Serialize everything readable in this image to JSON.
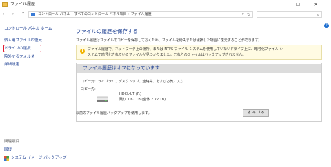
{
  "window": {
    "title": "ファイル履歴",
    "minimize": "—",
    "maximize": "☐",
    "close": "✕"
  },
  "nav": {
    "back": "←",
    "forward": "→",
    "up": "↑"
  },
  "address": {
    "crumbs": [
      "コントロール パネル",
      "すべてのコントロール パネル項目",
      "ファイル履歴"
    ],
    "separator": "›",
    "dropdown": "∨",
    "refresh": "↻"
  },
  "search": {
    "placeholder": "",
    "icon": "search-icon"
  },
  "help": "?",
  "sidebar": {
    "home": "コントロール パネル ホーム",
    "items": [
      "個人用ファイルの復元",
      "ドライブの選択",
      "除外するフォルダー",
      "詳細設定"
    ],
    "related_heading": "関連項目",
    "related": [
      "回復",
      "システム イメージ バックアップ"
    ]
  },
  "main": {
    "heading": "ファイルの履歴を保存する",
    "description": "ファイル履歴はファイルのコピーを保存しておくため、ファイルを紛失または破損した場合に復元することができます。",
    "info_lines": [
      "ファイル履歴で、ネットワーク上の場所、または NTFS ファイル システムを使用していないドライブ上に、暗号化ファイル シ",
      "ステムで暗号化されているファイルが見つかりました。これらのファイルはバックアップされません。"
    ],
    "panel_title": "ファイル履歴はオフになっています",
    "copy_label": "コピー元:",
    "copy_value": "ライブラリ、デスクトップ、連絡先、およびお気に入り",
    "dest_label": "コピー先:",
    "drive_name": "HDCL-UT (F:)",
    "drive_space": "残り 1.67 TB (全体 2.72 TB)",
    "footer": "以前のファイル履歴バックアップを使用します。",
    "on_button": "オンにする"
  },
  "colors": {
    "link": "#1a3d91",
    "highlight": "#e0182d",
    "info_bg": "#fffbe3",
    "panel_head": "#dcdcdc"
  }
}
